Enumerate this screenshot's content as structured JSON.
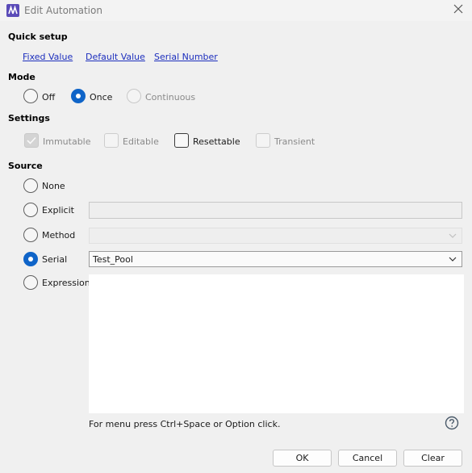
{
  "window": {
    "title": "Edit Automation"
  },
  "quick_setup": {
    "heading": "Quick setup",
    "links": [
      "Fixed Value",
      "Default Value",
      "Serial Number"
    ]
  },
  "mode": {
    "heading": "Mode",
    "options": [
      "Off",
      "Once",
      "Continuous"
    ],
    "selected": "Once"
  },
  "settings": {
    "heading": "Settings",
    "items": [
      {
        "label": "Immutable",
        "checked": true,
        "enabled": false
      },
      {
        "label": "Editable",
        "checked": false,
        "enabled": false
      },
      {
        "label": "Resettable",
        "checked": false,
        "enabled": true
      },
      {
        "label": "Transient",
        "checked": false,
        "enabled": false
      }
    ]
  },
  "source": {
    "heading": "Source",
    "options": [
      "None",
      "Explicit",
      "Method",
      "Serial",
      "Expression"
    ],
    "selected": "Serial",
    "explicit_value": "",
    "method_value": "",
    "serial_value": "Test_Pool",
    "expression_value": "",
    "hint": "For menu press Ctrl+Space or Option click."
  },
  "buttons": {
    "ok": "OK",
    "cancel": "Cancel",
    "clear": "Clear"
  },
  "colors": {
    "accent": "#0f64c8",
    "link": "#1c2ebd",
    "background": "#f0f0f0"
  }
}
